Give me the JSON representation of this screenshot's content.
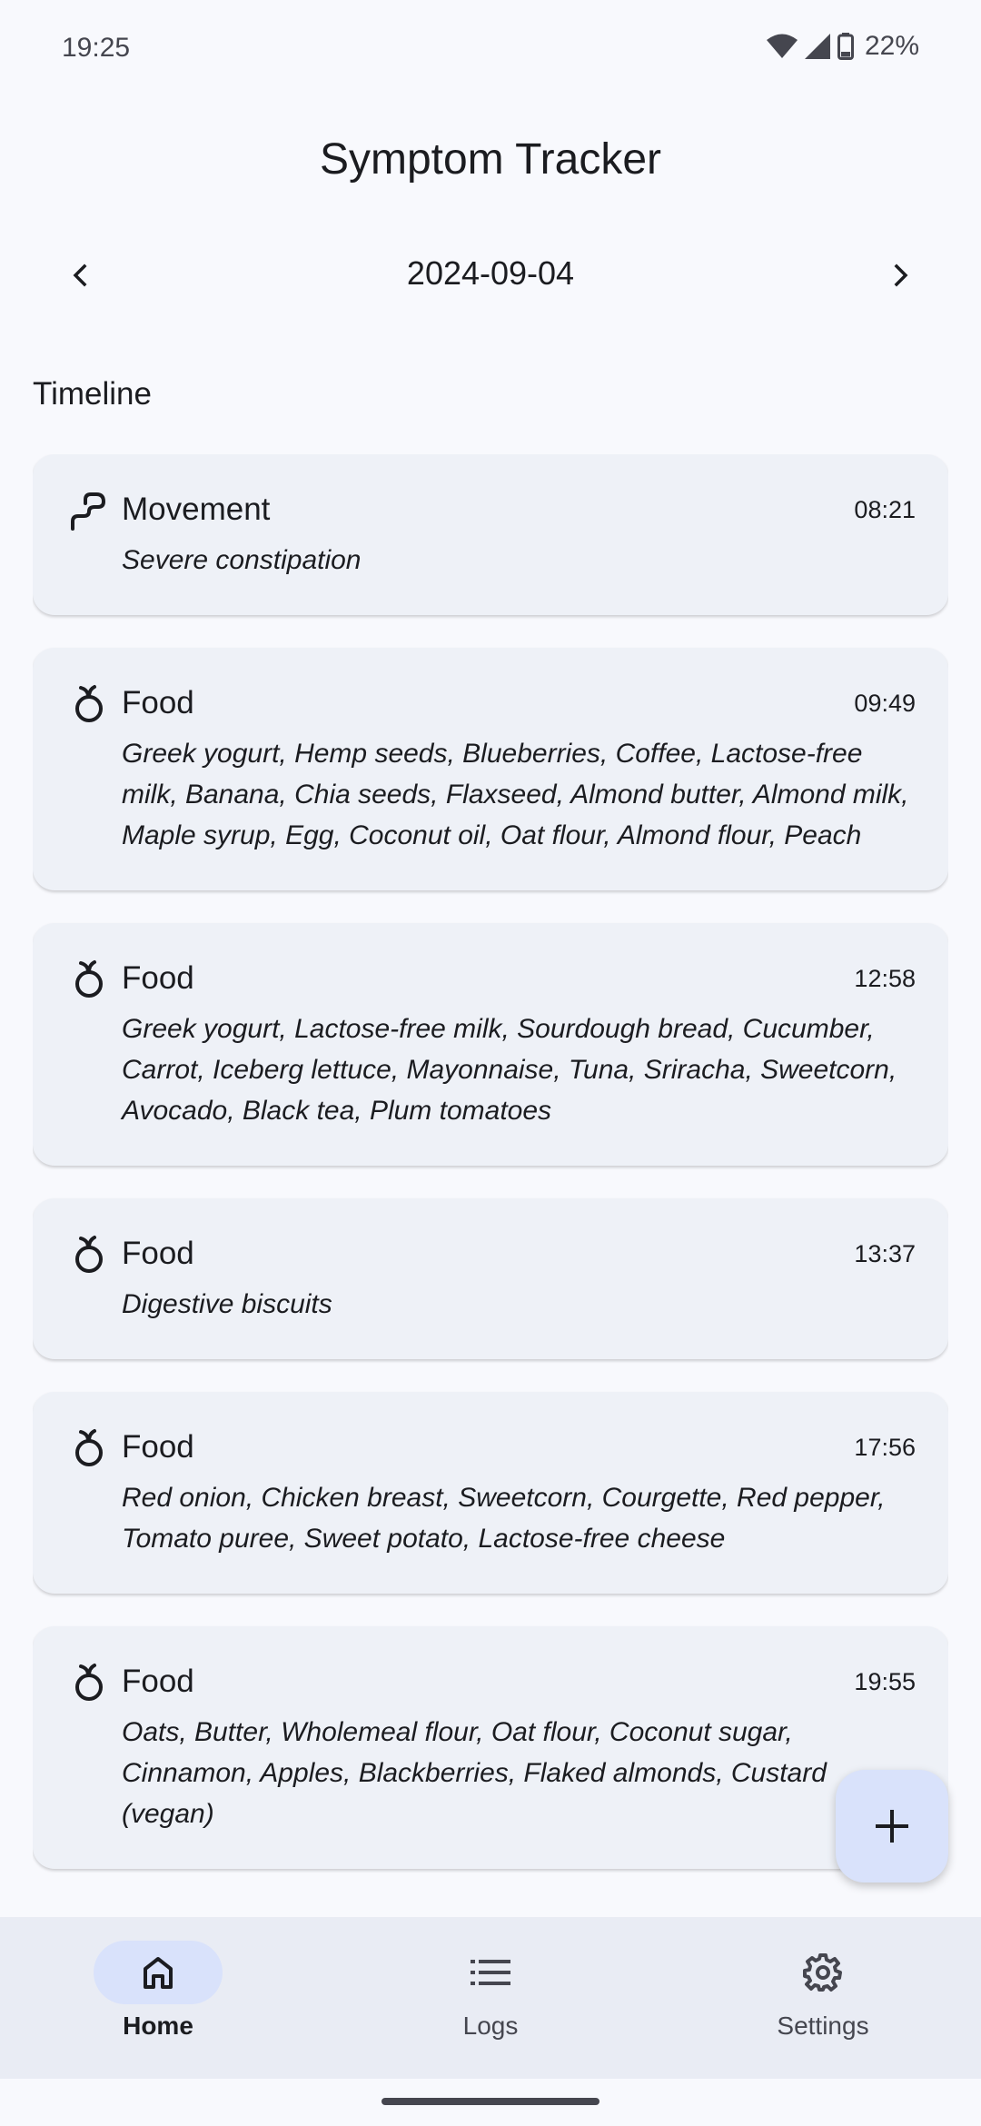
{
  "status": {
    "time": "19:25",
    "battery": "22%"
  },
  "app": {
    "title": "Symptom Tracker"
  },
  "date_nav": {
    "date": "2024-09-04"
  },
  "timeline": {
    "title": "Timeline",
    "entries": [
      {
        "type": "Movement",
        "icon": "bowel-movement-icon",
        "time": "08:21",
        "description": "Severe constipation"
      },
      {
        "type": "Food",
        "icon": "apple-icon",
        "time": "09:49",
        "description": "Greek yogurt, Hemp seeds, Blueberries, Coffee, Lactose-free milk, Banana, Chia seeds, Flaxseed, Almond butter, Almond milk, Maple syrup, Egg, Coconut oil, Oat flour, Almond flour, Peach"
      },
      {
        "type": "Food",
        "icon": "apple-icon",
        "time": "12:58",
        "description": "Greek yogurt, Lactose-free milk, Sourdough bread, Cucumber, Carrot, Iceberg lettuce, Mayonnaise, Tuna, Sriracha, Sweetcorn, Avocado, Black tea, Plum tomatoes"
      },
      {
        "type": "Food",
        "icon": "apple-icon",
        "time": "13:37",
        "description": "Digestive biscuits"
      },
      {
        "type": "Food",
        "icon": "apple-icon",
        "time": "17:56",
        "description": "Red onion, Chicken breast, Sweetcorn, Courgette, Red pepper, Tomato puree, Sweet potato, Lactose-free cheese"
      },
      {
        "type": "Food",
        "icon": "apple-icon",
        "time": "19:55",
        "description": "Oats, Butter, Wholemeal flour, Oat flour, Coconut sugar, Cinnamon, Apples, Blackberries, Flaked almonds, Custard (vegan)"
      }
    ]
  },
  "bottom_nav": {
    "items": [
      {
        "label": "Home",
        "icon": "home-icon",
        "active": true
      },
      {
        "label": "Logs",
        "icon": "list-icon",
        "active": false
      },
      {
        "label": "Settings",
        "icon": "gear-icon",
        "active": false
      }
    ]
  },
  "colors": {
    "background": "#f8f9fd",
    "card": "#eef1f7",
    "accent_container": "#d9e2fb",
    "nav_bar": "#e9ecf4"
  }
}
